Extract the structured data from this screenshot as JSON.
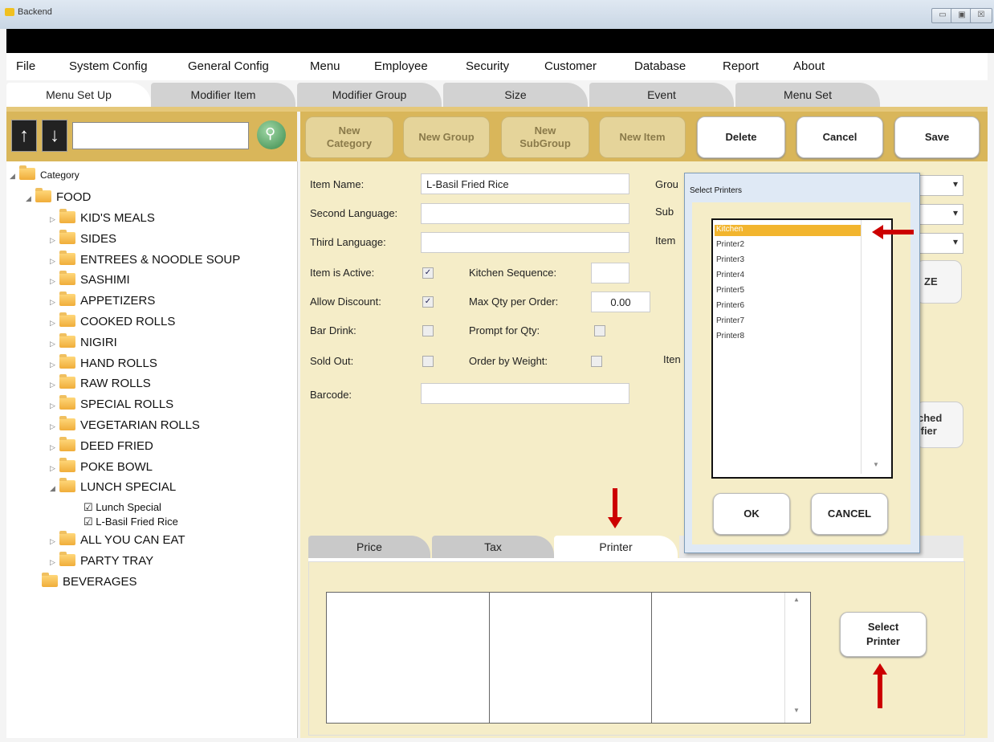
{
  "window": {
    "title": "Backend",
    "controls": [
      "▭",
      "▣",
      "☒"
    ]
  },
  "menu": [
    "File",
    "System Config",
    "General Config",
    "Menu",
    "Employee",
    "Security",
    "Customer",
    "Database",
    "Report",
    "About"
  ],
  "tabs": [
    "Menu Set Up",
    "Modifier Item",
    "Modifier Group",
    "Size",
    "Event",
    "Menu Set"
  ],
  "toolbar": {
    "new_category": "New\nCategory",
    "new_group": "New Group",
    "new_subgroup": "New\nSubGroup",
    "new_item": "New Item",
    "delete": "Delete",
    "cancel": "Cancel",
    "save": "Save"
  },
  "tree": {
    "root": "Category",
    "food": "FOOD",
    "food_children": [
      "KID'S MEALS",
      "SIDES",
      "ENTREES & NOODLE SOUP",
      "SASHIMI",
      "APPETIZERS",
      "COOKED ROLLS",
      "NIGIRI",
      "HAND ROLLS",
      "RAW ROLLS",
      "SPECIAL ROLLS",
      "VEGETARIAN ROLLS",
      "DEED FRIED",
      "POKE BOWL",
      "LUNCH SPECIAL"
    ],
    "lunch_items": [
      "Lunch Special",
      "L-Basil Fried Rice"
    ],
    "after": [
      "ALL YOU CAN EAT",
      "PARTY TRAY"
    ],
    "beverages": "BEVERAGES"
  },
  "form": {
    "item_name_label": "Item Name:",
    "item_name_value": "L-Basil Fried Rice",
    "second_language_label": "Second Language:",
    "third_language_label": "Third Language:",
    "item_active_label": "Item is Active:",
    "kitchen_seq_label": "Kitchen Sequence:",
    "allow_discount_label": "Allow Discount:",
    "max_qty_label": "Max Qty per Order:",
    "max_qty_value": "0.00",
    "bar_drink_label": "Bar Drink:",
    "prompt_qty_label": "Prompt for Qty:",
    "sold_out_label": "Sold Out:",
    "order_weight_label": "Order by Weight:",
    "barcode_label": "Barcode:",
    "group_label": "Grou",
    "sub_label": "Sub",
    "item_label": "Item",
    "item_label2": "Iten",
    "partial_btn_1": "ZE",
    "partial_btn_2": "ched\nifier"
  },
  "bottom_tabs": [
    "Price",
    "Tax",
    "Printer"
  ],
  "select_printer_button": "Select\nPrinter",
  "dialog": {
    "title": "Select Printers",
    "printers": [
      "Kitchen",
      "Printer2",
      "Printer3",
      "Printer4",
      "Printer5",
      "Printer6",
      "Printer7",
      "Printer8"
    ],
    "selected_index": 0,
    "ok": "OK",
    "cancel": "CANCEL"
  },
  "colors": {
    "toolbar_gold": "#d9b65a",
    "form_bg": "#f5edc8",
    "selection": "#f2b52e",
    "arrow_red": "#cc0000"
  }
}
